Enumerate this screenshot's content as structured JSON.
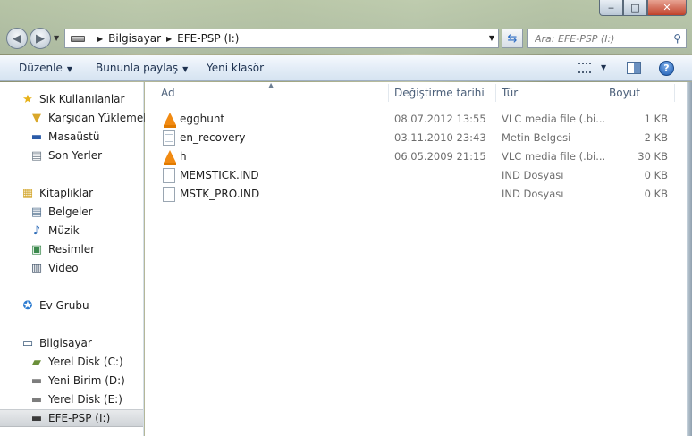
{
  "titlebar": {
    "minimize_glyph": "‒",
    "maximize_glyph": "□",
    "close_glyph": "✕"
  },
  "address": {
    "breadcrumbs": [
      "Bilgisayar",
      "EFE-PSP (I:)"
    ]
  },
  "search": {
    "placeholder": "Ara: EFE-PSP (I:)"
  },
  "toolbar": {
    "organize_label": "Düzenle",
    "share_label": "Bununla paylaş",
    "new_folder_label": "Yeni klasör",
    "help_glyph": "?"
  },
  "nav": {
    "favorites": {
      "label": "Sık Kullanılanlar",
      "items": [
        "Karşıdan Yüklemeler",
        "Masaüstü",
        "Son Yerler"
      ]
    },
    "libraries": {
      "label": "Kitaplıklar",
      "items": [
        "Belgeler",
        "Müzik",
        "Resimler",
        "Video"
      ]
    },
    "homegroup": {
      "label": "Ev Grubu"
    },
    "computer": {
      "label": "Bilgisayar",
      "items": [
        "Yerel Disk (C:)",
        "Yeni Birim (D:)",
        "Yerel Disk (E:)",
        "EFE-PSP (I:)"
      ]
    }
  },
  "columns": {
    "name": "Ad",
    "date": "Değiştirme tarihi",
    "type": "Tür",
    "size": "Boyut"
  },
  "files": [
    {
      "name": "egghunt",
      "date": "08.07.2012 13:55",
      "type": "VLC media file (.bi...",
      "size": "1 KB",
      "icon": "vlc-icon"
    },
    {
      "name": "en_recovery",
      "date": "03.11.2010 23:43",
      "type": "Metin Belgesi",
      "size": "2 KB",
      "icon": "text-document-icon"
    },
    {
      "name": "h",
      "date": "06.05.2009 21:15",
      "type": "VLC media file (.bi...",
      "size": "30 KB",
      "icon": "vlc-icon"
    },
    {
      "name": "MEMSTICK.IND",
      "date": "",
      "type": "IND Dosyası",
      "size": "0 KB",
      "icon": "blank-file-icon"
    },
    {
      "name": "MSTK_PRO.IND",
      "date": "",
      "type": "IND Dosyası",
      "size": "0 KB",
      "icon": "blank-file-icon"
    }
  ]
}
